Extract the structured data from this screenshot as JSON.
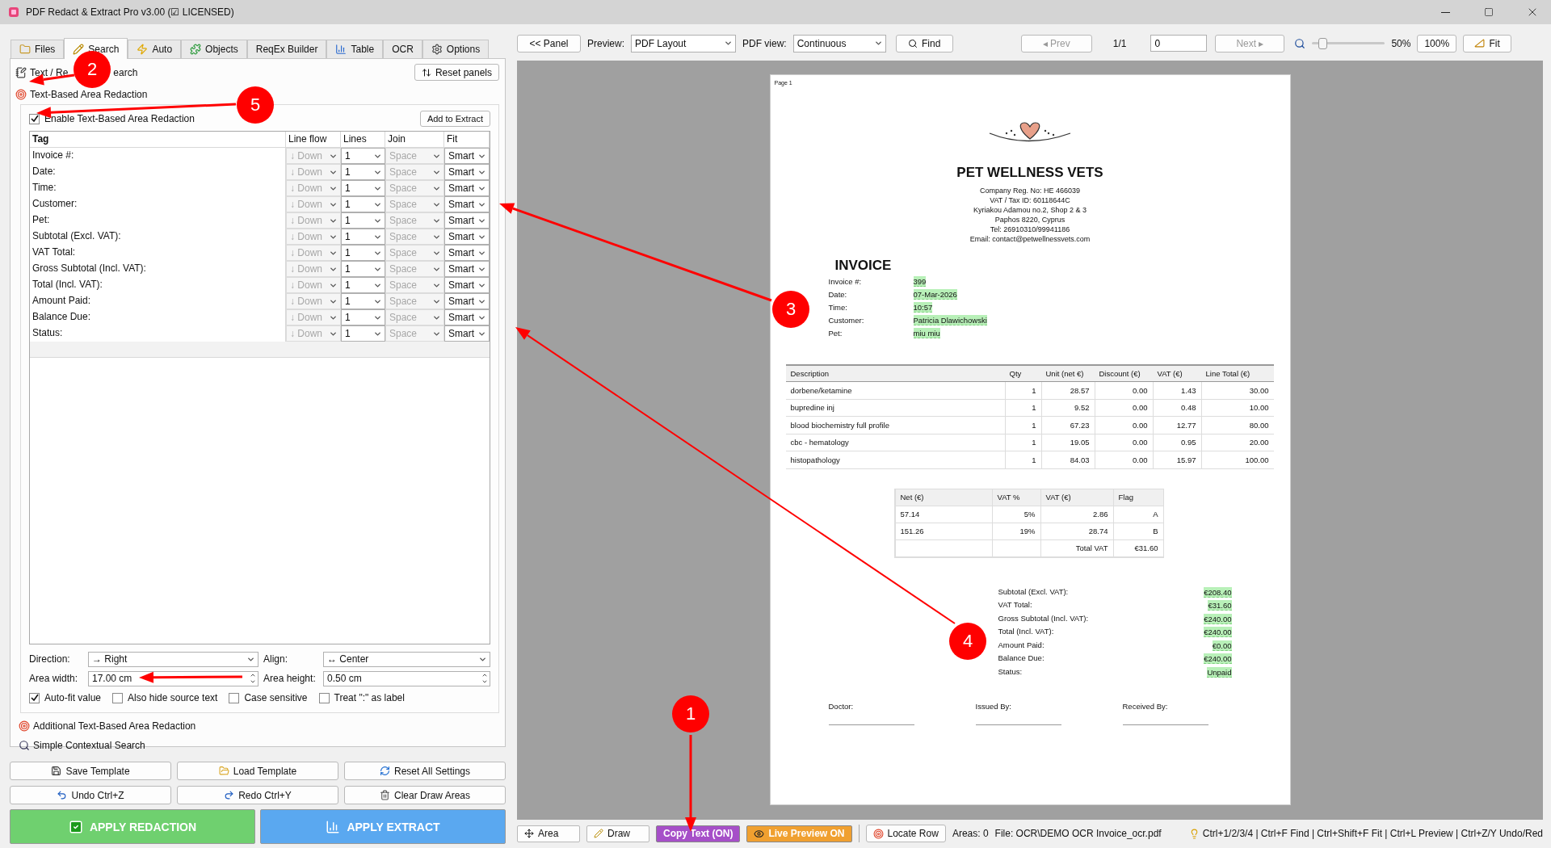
{
  "window": {
    "title": "PDF Redact & Extract Pro v3.00 (☑ LICENSED)"
  },
  "left_panel": {
    "tabs": [
      {
        "label": "Files",
        "selected": false
      },
      {
        "label": "Search",
        "selected": true
      },
      {
        "label": "Auto",
        "selected": false
      },
      {
        "label": "Objects",
        "selected": false
      },
      {
        "label": "ReqEx Builder",
        "selected": false
      },
      {
        "label": "Table",
        "selected": false
      },
      {
        "label": "OCR",
        "selected": false
      },
      {
        "label": "Options",
        "selected": false
      }
    ],
    "search_header": {
      "title_parts": [
        "Text / Re",
        "earch"
      ],
      "reset_button": "Reset panels"
    },
    "area_redaction": {
      "title": "Text-Based Area Redaction",
      "enable": {
        "label": "Enable Text-Based Area Redaction",
        "checked": true
      },
      "add_button": "Add to Extract",
      "columns": [
        "Tag",
        "Line flow",
        "Lines",
        "Join",
        "Fit"
      ],
      "line_flow_disabled": true,
      "join_disabled": true,
      "rows": [
        {
          "tag": "Invoice #:",
          "line_flow": "↓ Down",
          "lines": "1",
          "join": "Space",
          "fit": "Smart"
        },
        {
          "tag": "Date:",
          "line_flow": "↓ Down",
          "lines": "1",
          "join": "Space",
          "fit": "Smart"
        },
        {
          "tag": "Time:",
          "line_flow": "↓ Down",
          "lines": "1",
          "join": "Space",
          "fit": "Smart"
        },
        {
          "tag": "Customer:",
          "line_flow": "↓ Down",
          "lines": "1",
          "join": "Space",
          "fit": "Smart"
        },
        {
          "tag": "Pet:",
          "line_flow": "↓ Down",
          "lines": "1",
          "join": "Space",
          "fit": "Smart"
        },
        {
          "tag": "Subtotal (Excl. VAT):",
          "line_flow": "↓ Down",
          "lines": "1",
          "join": "Space",
          "fit": "Smart"
        },
        {
          "tag": "VAT Total:",
          "line_flow": "↓ Down",
          "lines": "1",
          "join": "Space",
          "fit": "Smart"
        },
        {
          "tag": "Gross Subtotal (Incl. VAT):",
          "line_flow": "↓ Down",
          "lines": "1",
          "join": "Space",
          "fit": "Smart"
        },
        {
          "tag": "Total (Incl. VAT):",
          "line_flow": "↓ Down",
          "lines": "1",
          "join": "Space",
          "fit": "Smart"
        },
        {
          "tag": "Amount Paid:",
          "line_flow": "↓ Down",
          "lines": "1",
          "join": "Space",
          "fit": "Smart"
        },
        {
          "tag": "Balance Due:",
          "line_flow": "↓ Down",
          "lines": "1",
          "join": "Space",
          "fit": "Smart"
        },
        {
          "tag": "Status:",
          "line_flow": "↓ Down",
          "lines": "1",
          "join": "Space",
          "fit": "Smart"
        }
      ],
      "direction": {
        "label": "Direction:",
        "value": "→ Right"
      },
      "align": {
        "label": "Align:",
        "value": "↔ Center"
      },
      "area_width": {
        "label": "Area width:",
        "value": "17.00 cm"
      },
      "area_height": {
        "label": "Area height:",
        "value": "0.50 cm"
      },
      "options": [
        {
          "label": "Auto-fit value",
          "checked": true
        },
        {
          "label": "Also hide source text",
          "checked": false
        },
        {
          "label": "Case sensitive",
          "checked": false
        },
        {
          "label": "Treat \":\" as label",
          "checked": false
        }
      ]
    },
    "more_sections": [
      "Additional Text-Based Area Redaction",
      "Simple Contextual Search"
    ],
    "buttons": [
      "Save Template",
      "Load Template",
      "Reset All Settings",
      "Undo  Ctrl+Z",
      "Redo  Ctrl+Y",
      "Clear Draw Areas"
    ],
    "apply_redaction": "APPLY REDACTION",
    "apply_extract": "APPLY EXTRACT"
  },
  "toolbar": {
    "panel_button": "<< Panel",
    "preview_label": "Preview:",
    "preview_value": "PDF Layout",
    "view_label": "PDF view:",
    "view_value": "Continuous",
    "find_button": "Find",
    "prev_button": {
      "label": "◂ Prev",
      "disabled": true
    },
    "page_count": "1/1",
    "page_input": "0",
    "next_button": {
      "label": "Next ▸",
      "disabled": true
    },
    "zoom": {
      "level": 0.1,
      "reading": "50%"
    },
    "zoom_100": "100%",
    "fit_button": "Fit"
  },
  "document": {
    "page_label": "Page 1",
    "company": "PET WELLNESS VETS",
    "address_lines": [
      "Company Reg. No: HE 466039",
      "VAT / Tax ID: 60118644C",
      "Kyriakou Adamou no.2, Shop 2 & 3",
      "Paphos 8220, Cyprus",
      "Tel: 26910310/99941186",
      "Email: contact@petwellnessvets.com"
    ],
    "heading": "INVOICE",
    "fields": [
      {
        "label": "Invoice #:",
        "value": "399",
        "highlighted": true
      },
      {
        "label": "Date:",
        "value": "07-Mar-2026",
        "highlighted": true
      },
      {
        "label": "Time:",
        "value": "10:57",
        "highlighted": true
      },
      {
        "label": "Customer:",
        "value": "Patricia Dlawichowski",
        "highlighted": true
      },
      {
        "label": "Pet:",
        "value": "miu miu",
        "highlighted": true
      }
    ],
    "items": {
      "columns": [
        "Description",
        "Qty",
        "Unit (net €)",
        "Discount (€)",
        "VAT (€)",
        "Line Total (€)"
      ],
      "rows": [
        [
          "dorbene/ketamine",
          "1",
          "28.57",
          "0.00",
          "1.43",
          "30.00"
        ],
        [
          "bupredine inj",
          "1",
          "9.52",
          "0.00",
          "0.48",
          "10.00"
        ],
        [
          "blood biochemistry full profile",
          "1",
          "67.23",
          "0.00",
          "12.77",
          "80.00"
        ],
        [
          "cbc - hematology",
          "1",
          "19.05",
          "0.00",
          "0.95",
          "20.00"
        ],
        [
          "histopathology",
          "1",
          "84.03",
          "0.00",
          "15.97",
          "100.00"
        ]
      ]
    },
    "vat_table": {
      "columns": [
        "Net (€)",
        "VAT %",
        "VAT (€)",
        "Flag"
      ],
      "rows": [
        [
          "57.14",
          "5%",
          "2.86",
          "A"
        ],
        [
          "151.26",
          "19%",
          "28.74",
          "B"
        ]
      ],
      "total": {
        "label": "Total VAT",
        "value": "€31.60"
      }
    },
    "totals": [
      {
        "label": "Subtotal (Excl. VAT):",
        "value": "€208.40",
        "highlighted": true
      },
      {
        "label": "VAT Total:",
        "value": "€31.60",
        "highlighted": true
      },
      {
        "label": "Gross Subtotal (Incl. VAT):",
        "value": "€240.00",
        "highlighted": true
      },
      {
        "label": "Total (Incl. VAT):",
        "value": "€240.00",
        "highlighted": true
      },
      {
        "label": "Amount Paid:",
        "value": "€0.00",
        "highlighted": true
      },
      {
        "label": "Balance Due:",
        "value": "€240.00",
        "highlighted": true
      },
      {
        "label": "Status:",
        "value": "Unpaid",
        "highlighted": true
      }
    ],
    "signatures": [
      "Doctor:",
      "Issued By:",
      "Received By:"
    ]
  },
  "status_bar": {
    "buttons": [
      {
        "label": "Area",
        "on": false
      },
      {
        "label": "Draw",
        "on": false
      },
      {
        "label": "Copy Text (ON)",
        "on": true,
        "color": "#a64fc8"
      },
      {
        "label": "Live Preview ON",
        "on": true,
        "color": "#f0a030"
      }
    ],
    "locate_button": "Locate Row",
    "areas": "Areas: 0",
    "file": "File: OCR\\DEMO OCR Invoice_ocr.pdf",
    "shortcuts": "Ctrl+1/2/3/4 | Ctrl+F Find | Ctrl+Shift+F Fit | Ctrl+L Preview | Ctrl+Z/Y Undo/Red"
  },
  "annotations": [
    {
      "label": "1"
    },
    {
      "label": "2"
    },
    {
      "label": "3"
    },
    {
      "label": "4"
    },
    {
      "label": "5"
    }
  ]
}
